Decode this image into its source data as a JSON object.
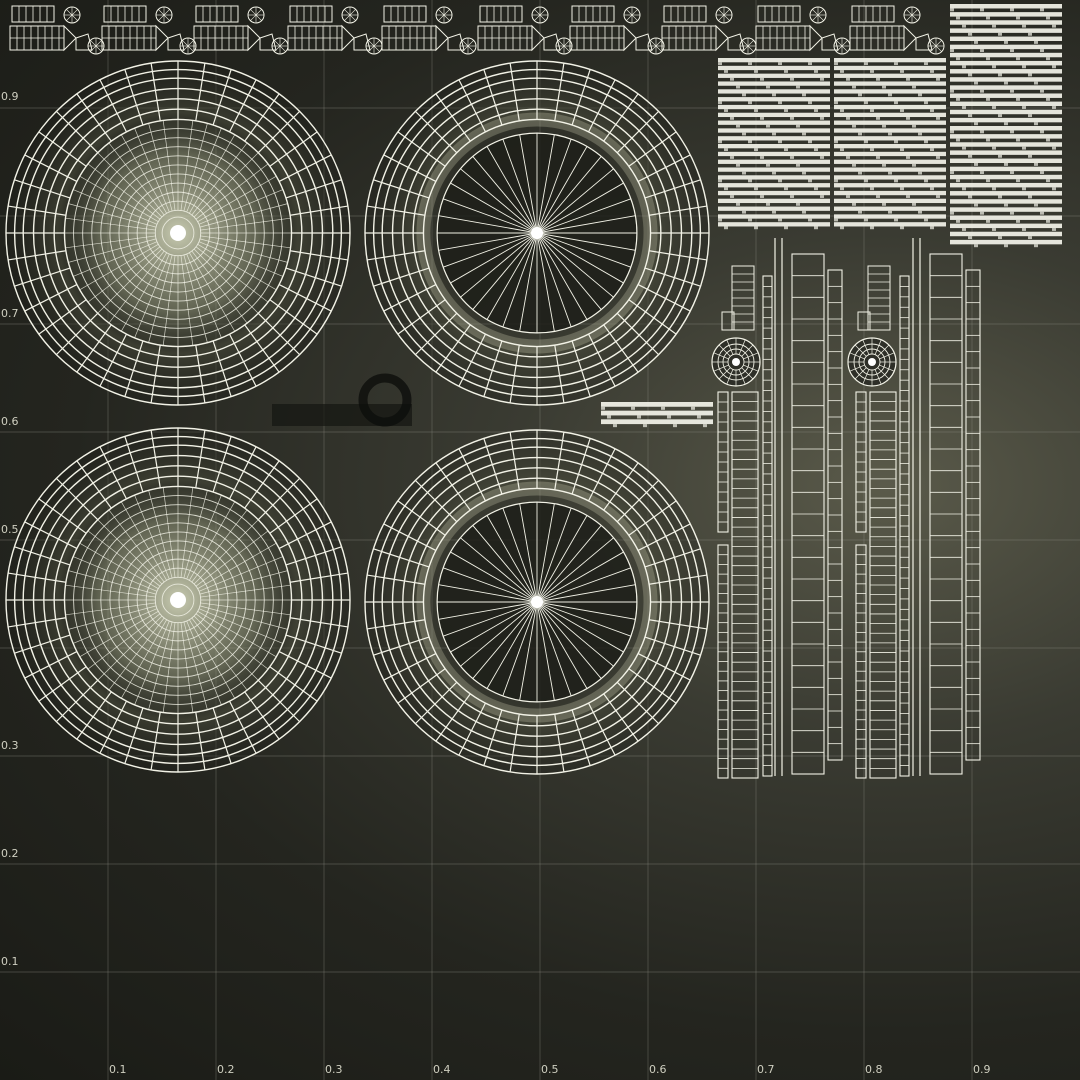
{
  "canvas": {
    "v_labels": [
      "0.9",
      "0.7",
      "0.6",
      "0.5",
      "0.3",
      "0.2",
      "0.1"
    ],
    "u_labels": [
      "0.1",
      "0.2",
      "0.3",
      "0.4",
      "0.5",
      "0.6",
      "0.7",
      "0.8",
      "0.9"
    ]
  },
  "colors": {
    "background": "#23241e",
    "wire": "#f2f2e6",
    "grid": "#8a8a80",
    "ring_fill": "#cfd2b4",
    "tread_pattern": "#111210"
  },
  "icons": [
    "uv-wheel-shell",
    "uv-tread-strip",
    "uv-sidewall-strip",
    "uv-hub-island"
  ]
}
